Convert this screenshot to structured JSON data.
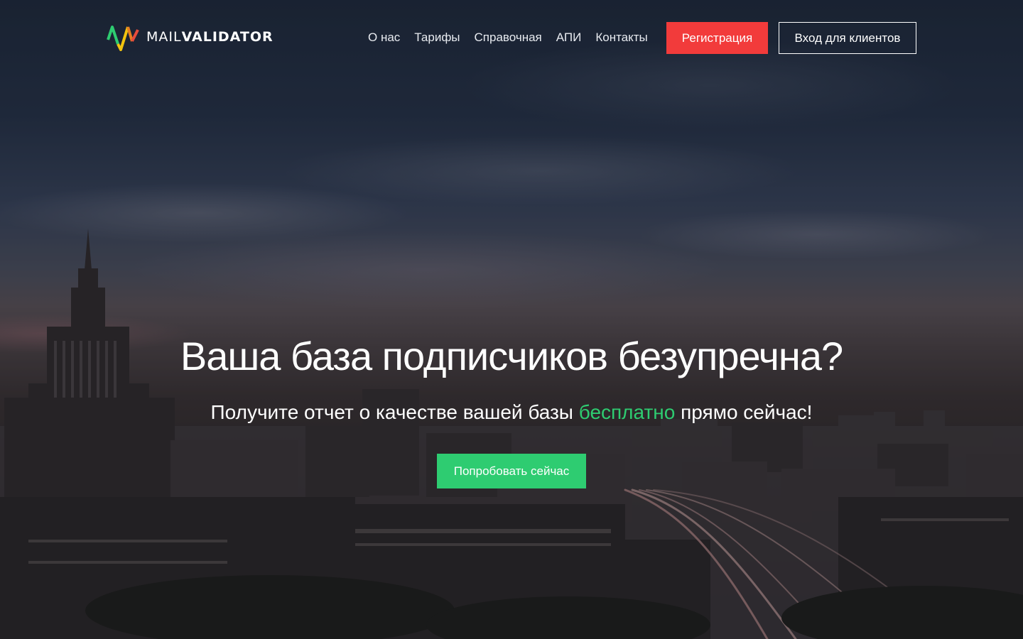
{
  "brand": {
    "name_light": "MAIL",
    "name_bold": "VALIDATOR",
    "logo_icon": "logo-v-mark-icon",
    "colors": [
      "#2ecc71",
      "#f1c40f",
      "#e67e22",
      "#e74c3c"
    ]
  },
  "nav": {
    "items": [
      {
        "label": "О нас"
      },
      {
        "label": "Тарифы"
      },
      {
        "label": "Справочная"
      },
      {
        "label": "АПИ"
      },
      {
        "label": "Контакты"
      }
    ],
    "register_label": "Регистрация",
    "login_label": "Вход для клиентов"
  },
  "hero": {
    "title": "Ваша база подписчиков безупречна?",
    "subtitle_before": "Получите отчет о качестве вашей базы ",
    "subtitle_accent": "бесплатно",
    "subtitle_after": " прямо сейчас!",
    "cta_label": "Попробовать сейчас"
  },
  "colors": {
    "register": "#f23b3b",
    "accent_green": "#2ecc71"
  }
}
